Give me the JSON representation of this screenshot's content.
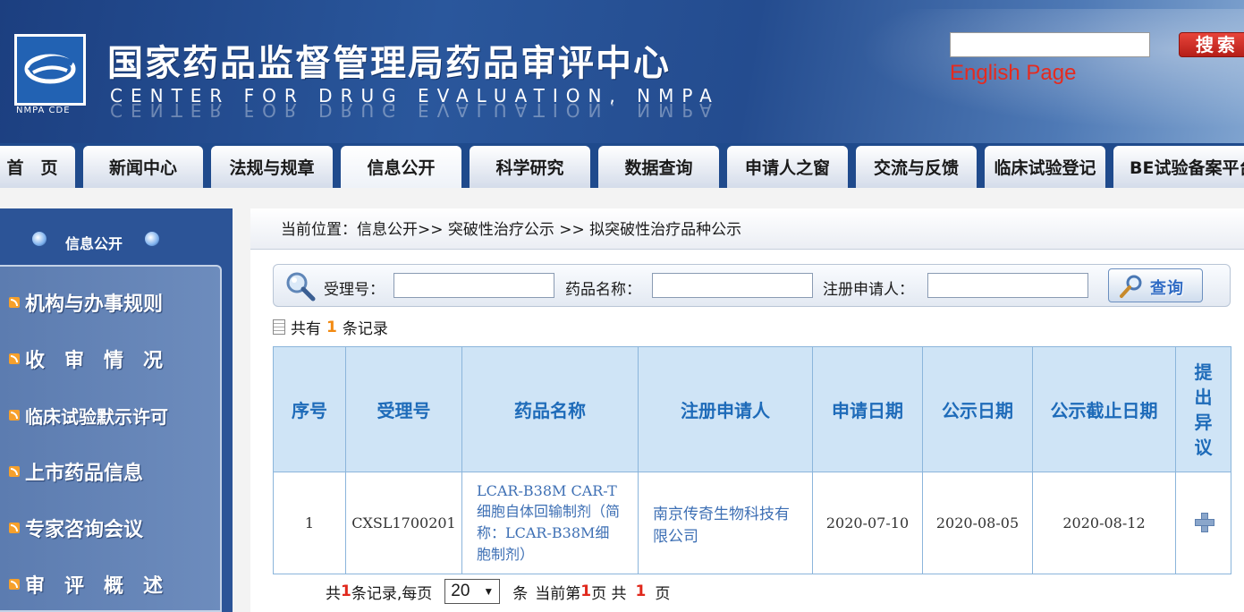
{
  "header": {
    "title": "国家药品监督管理局药品审评中心",
    "subtitle": "CENTER FOR DRUG EVALUATION, NMPA",
    "logo_caption": "NMPA CDE",
    "search_value": "",
    "search_button": "搜索",
    "english_link": "English Page"
  },
  "nav": {
    "tabs": [
      {
        "label": "首　页"
      },
      {
        "label": "新闻中心"
      },
      {
        "label": "法规与规章"
      },
      {
        "label": "信息公开"
      },
      {
        "label": "科学研究"
      },
      {
        "label": "数据查询"
      },
      {
        "label": "申请人之窗"
      },
      {
        "label": "交流与反馈"
      },
      {
        "label": "临床试验登记"
      },
      {
        "label": "BE试验备案平台"
      }
    ],
    "active_index": 3
  },
  "sidebar": {
    "title": "信息公开",
    "items": [
      {
        "label": "机构与办事规则"
      },
      {
        "label": "收　审　情　况"
      },
      {
        "label": "临床试验默示许可"
      },
      {
        "label": "上市药品信息"
      },
      {
        "label": "专家咨询会议"
      },
      {
        "label": "审　评　概　述"
      }
    ]
  },
  "main": {
    "breadcrumb": "当前位置：信息公开>> 突破性治疗公示 >> 拟突破性治疗品种公示",
    "filters": {
      "accept_no_label": "受理号：",
      "drug_name_label": "药品名称：",
      "applicant_label": "注册申请人：",
      "accept_no_value": "",
      "drug_name_value": "",
      "applicant_value": "",
      "query_button": "查询"
    },
    "count": {
      "prefix": "共有",
      "value": "1",
      "suffix": "条记录"
    },
    "table": {
      "headers": [
        "序号",
        "受理号",
        "药品名称",
        "注册申请人",
        "申请日期",
        "公示日期",
        "公示截止日期",
        "提出异议"
      ],
      "rows": [
        {
          "index": "1",
          "accept_no": "CXSL1700201",
          "drug_name": "LCAR-B38M CAR-T细胞自体回输制剂（简称：LCAR-B38M细胞制剂）",
          "applicant": "南京传奇生物科技有限公司",
          "apply_date": "2020-07-10",
          "publish_date": "2020-08-05",
          "deadline": "2020-08-12"
        }
      ]
    },
    "pager": {
      "total_prefix": "共",
      "total": "1",
      "total_suffix": "条记录,每页",
      "page_size": "20",
      "unit": "条",
      "current_prefix": "当前第",
      "current": "1",
      "current_suffix": "页 共",
      "pages": "1",
      "pages_suffix": "页"
    }
  },
  "colors": {
    "header_blue": "#244c8f",
    "nav_blue": "#1f4a8c",
    "table_header_bg": "#cfe4f6",
    "table_header_text": "#1e6bb9",
    "accent_red": "#e62a1e",
    "count_orange": "#f28a12"
  }
}
